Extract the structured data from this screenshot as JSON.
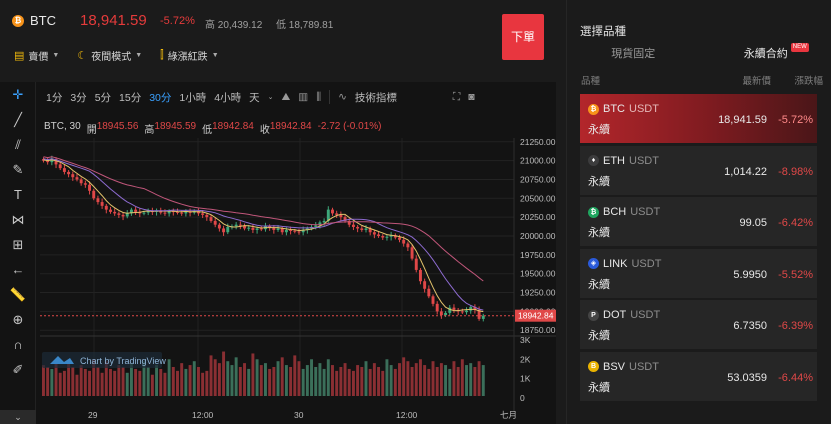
{
  "header": {
    "pair": "BTC",
    "price": "18,941.59",
    "change": "-5.72%",
    "high_label": "高",
    "high_value": "20,439.12",
    "low_label": "低",
    "low_value": "18,789.81",
    "tools": [
      "賣價",
      "夜間模式",
      "綠漲紅跌"
    ],
    "sell_button": "下單"
  },
  "toolbar": {
    "intervals": [
      "1分",
      "3分",
      "5分",
      "15分",
      "30分",
      "1小時",
      "4小時",
      "天"
    ],
    "active_interval": "30分",
    "indicators_label": "技術指標"
  },
  "legend": {
    "symbol": "BTC, 30",
    "open_label": "開",
    "open": "18945.56",
    "high_label": "高",
    "high": "18945.59",
    "low_label": "低",
    "low": "18942.84",
    "close_label": "收",
    "close": "18942.84",
    "change": "-2.72 (-0.01%)"
  },
  "chart_data": {
    "type": "candlestick",
    "y_axis_ticks": [
      21250,
      21000,
      20750,
      20500,
      20250,
      20000,
      19750,
      19500,
      19250,
      19000,
      18750
    ],
    "y_axis_labels": [
      "21250.00",
      "21000.00",
      "20750.00",
      "20500.00",
      "20250.00",
      "20000.00",
      "19750.00",
      "19500.00",
      "19250.00",
      "19000.00",
      "18750.00"
    ],
    "ylim": [
      18700,
      21300
    ],
    "current_price_label": "18942.84",
    "volume_axis_labels": [
      "3K",
      "2K",
      "1K",
      "0"
    ],
    "x_axis_labels": [
      "29",
      "12:00",
      "30",
      "12:00",
      "七月"
    ],
    "closes": [
      21000,
      20980,
      21020,
      20950,
      20900,
      20850,
      20820,
      20780,
      20750,
      20700,
      20680,
      20600,
      20500,
      20450,
      20400,
      20350,
      20320,
      20300,
      20280,
      20260,
      20300,
      20350,
      20320,
      20300,
      20310,
      20330,
      20320,
      20340,
      20310,
      20300,
      20330,
      20320,
      20310,
      20300,
      20320,
      20310,
      20330,
      20300,
      20280,
      20250,
      20200,
      20150,
      20100,
      20050,
      20120,
      20130,
      20150,
      20140,
      20100,
      20110,
      20080,
      20100,
      20090,
      20130,
      20110,
      20080,
      20100,
      20050,
      20080,
      20070,
      20060,
      20050,
      20080,
      20100,
      20120,
      20140,
      20180,
      20200,
      20350,
      20300,
      20280,
      20250,
      20200,
      20150,
      20120,
      20100,
      20080,
      20100,
      20050,
      20020,
      20000,
      19980,
      19990,
      20010,
      19980,
      19950,
      19900,
      19850,
      19700,
      19550,
      19400,
      19300,
      19200,
      19100,
      19000,
      18950,
      18980,
      19050,
      19020,
      19000,
      18990,
      19010,
      19060,
      19020,
      18900,
      18942.84
    ],
    "volumes": [
      1600,
      1500,
      1400,
      1800,
      1200,
      1300,
      1700,
      1500,
      1100,
      1600,
      1400,
      1300,
      1900,
      1500,
      1200,
      1800,
      1400,
      1300,
      1600,
      1500,
      1200,
      1700,
      1400,
      1300,
      1800,
      1500,
      1100,
      1600,
      1400,
      1200,
      1900,
      1500,
      1300,
      1700,
      1400,
      1600,
      1800,
      1500,
      1200,
      1300,
      2100,
      1900,
      1700,
      2300,
      1800,
      1600,
      2000,
      1500,
      1700,
      1400,
      2200,
      1900,
      1600,
      1700,
      1400,
      1500,
      1800,
      2000,
      1600,
      1500,
      2100,
      1800,
      1400,
      1600,
      1900,
      1500,
      1700,
      1400,
      1900,
      1600,
      1300,
      1500,
      1700,
      1400,
      1300,
      1600,
      1500,
      1800,
      1400,
      1700,
      1500,
      1300,
      1900,
      1600,
      1400,
      1700,
      2000,
      1800,
      1500,
      1700,
      1900,
      1600,
      1400,
      1800,
      1500,
      1700,
      1600,
      1400,
      1800,
      1500,
      1900,
      1600,
      1700,
      1500,
      1800,
      1600
    ]
  },
  "watermark": "Chart by TradingView",
  "panel": {
    "title": "選擇品種",
    "tabs": [
      "現貨固定",
      "永續合約"
    ],
    "active_tab": "永續合約",
    "new_badge": "NEW",
    "headers": [
      "品種",
      "最新價",
      "漲跌幅"
    ],
    "rows": [
      {
        "symbol": "BTC",
        "quote": "USDT",
        "kind": "永續",
        "price": "18,941.59",
        "change": "-5.72%",
        "color": "#f7931a",
        "glyph": "₿"
      },
      {
        "symbol": "ETH",
        "quote": "USDT",
        "kind": "永續",
        "price": "1,014.22",
        "change": "-8.98%",
        "color": "#3c3c3d",
        "glyph": "♦"
      },
      {
        "symbol": "BCH",
        "quote": "USDT",
        "kind": "永續",
        "price": "99.05",
        "change": "-6.42%",
        "color": "#1fa55f",
        "glyph": "₿"
      },
      {
        "symbol": "LINK",
        "quote": "USDT",
        "kind": "永續",
        "price": "5.9950",
        "change": "-5.52%",
        "color": "#2a5ada",
        "glyph": "◈"
      },
      {
        "symbol": "DOT",
        "quote": "USDT",
        "kind": "永續",
        "price": "6.7350",
        "change": "-6.39%",
        "color": "#444",
        "glyph": "P"
      },
      {
        "symbol": "BSV",
        "quote": "USDT",
        "kind": "永續",
        "price": "53.0359",
        "change": "-6.44%",
        "color": "#eab300",
        "glyph": "B"
      }
    ]
  },
  "colors": {
    "up": "#3ea87a",
    "down": "#e04848",
    "accent": "#3aa1ff",
    "sell": "#e8363f"
  }
}
